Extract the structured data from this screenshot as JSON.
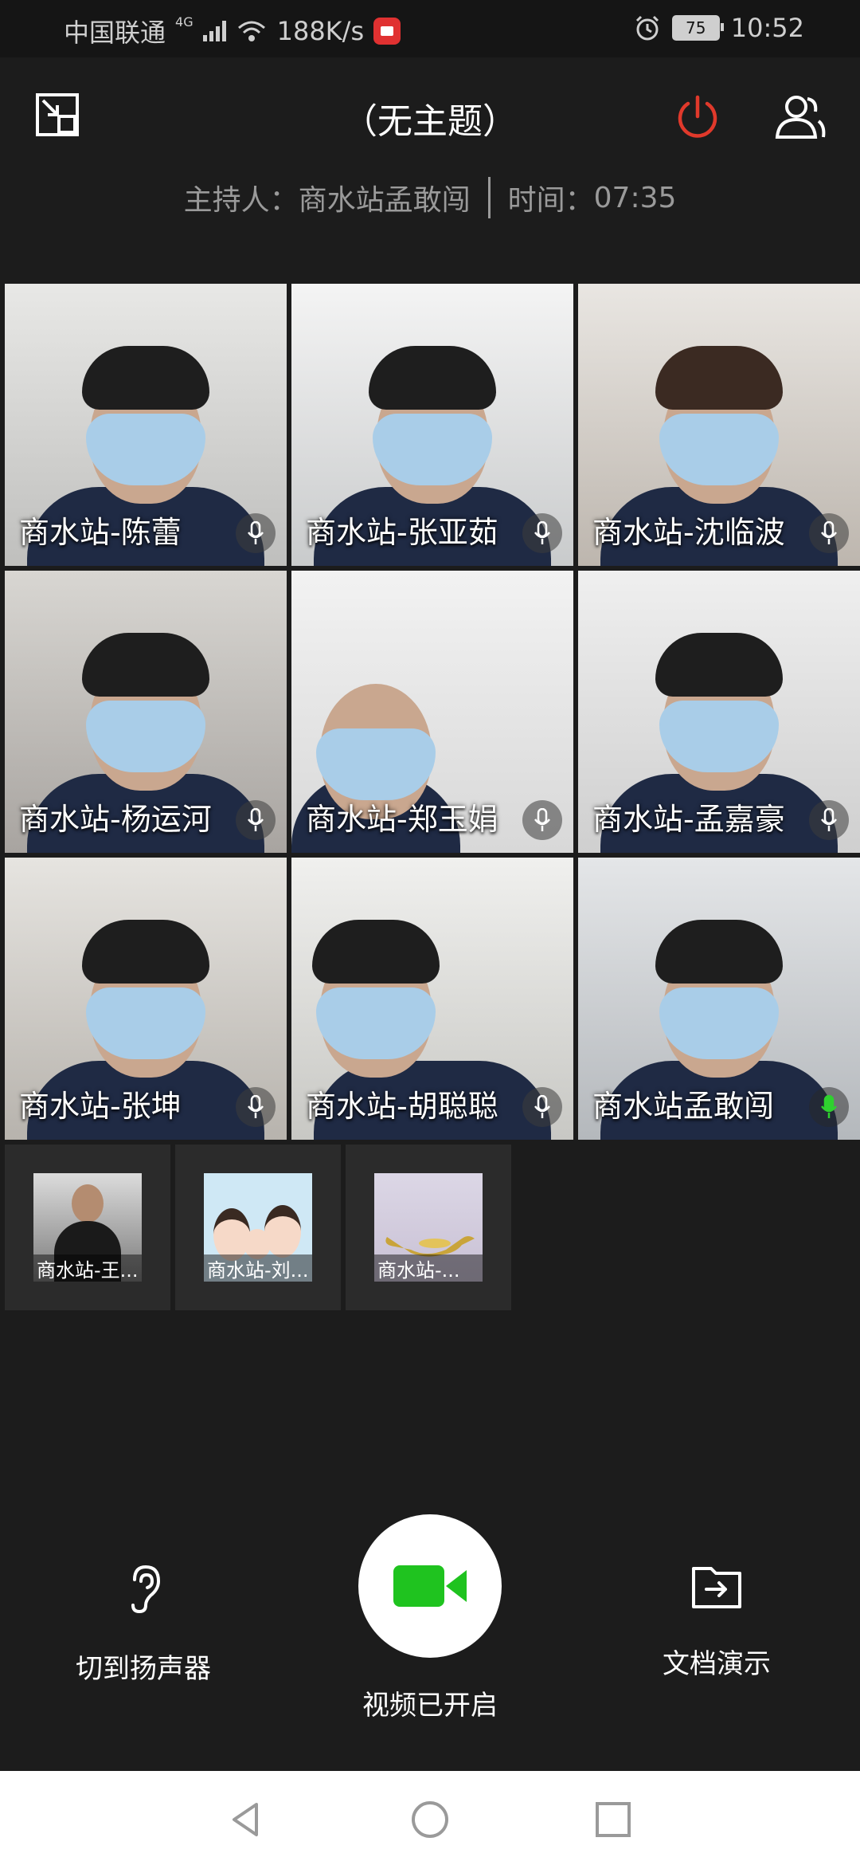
{
  "status_bar": {
    "carrier": "中国联通",
    "network": "4G",
    "speed": "188K/s",
    "battery": "75",
    "time": "10:52",
    "icons": [
      "signal-icon",
      "wifi-icon",
      "screen-record-icon",
      "alarm-icon",
      "battery-icon"
    ]
  },
  "header": {
    "title": "（无主题）",
    "icons": {
      "left": "exit-fullscreen-icon",
      "power": "power-icon",
      "members": "members-icon"
    },
    "power_color": "#e0392b"
  },
  "info": {
    "host_label": "主持人：",
    "host_name": "商水站孟敢闯",
    "time_label": "时间：",
    "time_value": "07:35"
  },
  "participants": [
    {
      "name": "商水站-陈蕾",
      "mic_active": false
    },
    {
      "name": "商水站-张亚茹",
      "mic_active": false
    },
    {
      "name": "商水站-沈临波",
      "mic_active": false
    },
    {
      "name": "商水站-杨运河",
      "mic_active": false
    },
    {
      "name": "商水站-郑玉娟",
      "mic_active": false
    },
    {
      "name": "商水站-孟嘉豪",
      "mic_active": false
    },
    {
      "name": "商水站-张坤",
      "mic_active": false
    },
    {
      "name": "商水站-胡聪聪",
      "mic_active": false
    },
    {
      "name": "商水站孟敢闯",
      "mic_active": true
    }
  ],
  "audio_only": [
    {
      "label": "商水站-王..."
    },
    {
      "label": "商水站-刘..."
    },
    {
      "label": "商水站-..."
    }
  ],
  "controls": {
    "speaker_label": "切到扬声器",
    "video_label": "视频已开启",
    "doc_label": "文档演示",
    "video_color": "#1fc31f"
  },
  "nav": {
    "icons": [
      "back-icon",
      "home-icon",
      "recents-icon"
    ]
  }
}
